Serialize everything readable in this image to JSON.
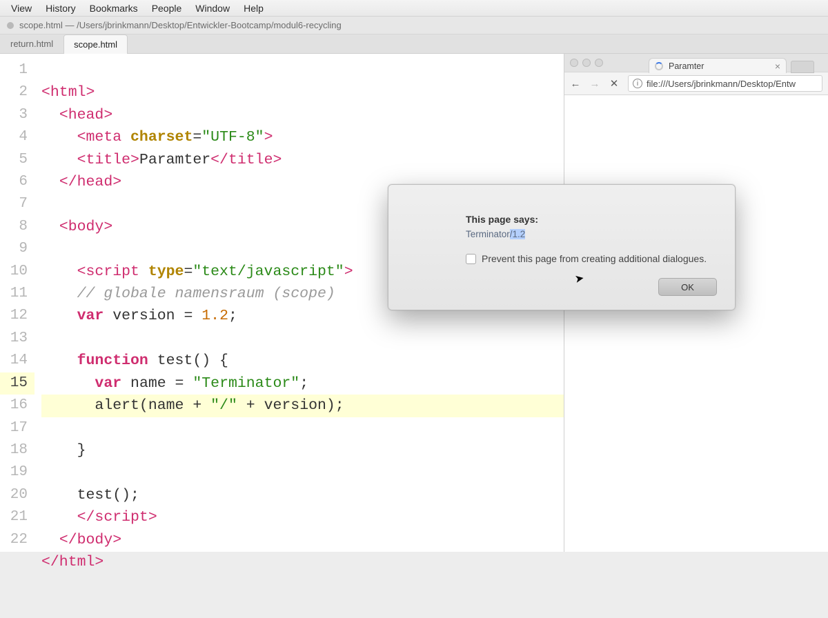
{
  "menubar": {
    "items": [
      "View",
      "History",
      "Bookmarks",
      "People",
      "Window",
      "Help"
    ]
  },
  "editor": {
    "title": "scope.html — /Users/jbrinkmann/Desktop/Entwickler-Bootcamp/modul6-recycling",
    "tabs": [
      {
        "label": "return.html",
        "active": false
      },
      {
        "label": "scope.html",
        "active": true
      }
    ],
    "lineNumbers": [
      "1",
      "2",
      "3",
      "4",
      "5",
      "6",
      "7",
      "8",
      "9",
      "10",
      "11",
      "12",
      "13",
      "14",
      "15",
      "16",
      "17",
      "18",
      "19",
      "20",
      "21",
      "22"
    ],
    "highlightLine": 15,
    "code": {
      "l1": {
        "tag1": "<html>",
        "raw": ""
      },
      "l2": {
        "indent": "  ",
        "tag": "<head>"
      },
      "l3": {
        "indent": "    ",
        "tagOpen": "<meta ",
        "attr": "charset",
        "eq": "=",
        "str": "\"UTF-8\"",
        "tagClose": ">"
      },
      "l4": {
        "indent": "    ",
        "open": "<title>",
        "text": "Paramter",
        "close": "</title>"
      },
      "l5": {
        "indent": "  ",
        "tag": "</head>"
      },
      "l6": {
        "raw": ""
      },
      "l7": {
        "indent": "  ",
        "tag": "<body>"
      },
      "l8": {
        "raw": ""
      },
      "l9": {
        "indent": "    ",
        "tagOpen": "<script ",
        "attr": "type",
        "eq": "=",
        "str": "\"text/javascript\"",
        "tagClose": ">"
      },
      "l10": {
        "indent": "    ",
        "comment": "// globale namensraum (scope)"
      },
      "l11": {
        "indent": "    ",
        "kw": "var",
        "rest1": " version = ",
        "num": "1.2",
        "rest2": ";"
      },
      "l12": {
        "raw": ""
      },
      "l13": {
        "indent": "    ",
        "kw": "function",
        "rest": " test() {"
      },
      "l14": {
        "indent": "      ",
        "kw": "var",
        "rest1": " name = ",
        "str": "\"Terminator\"",
        "rest2": ";"
      },
      "l15": {
        "indent": "      ",
        "rest1": "alert(name + ",
        "str1": "\"/\"",
        "rest2": " + version);"
      },
      "l16": {
        "indent": "    ",
        "rest": "}"
      },
      "l17": {
        "raw": ""
      },
      "l18": {
        "indent": "    ",
        "rest": "test();"
      },
      "l19": {
        "indent": "    ",
        "tag": "</script>"
      },
      "l20": {
        "indent": "  ",
        "tag": "</body>"
      },
      "l21": {
        "tag": "</html>"
      },
      "l22": {
        "raw": ""
      }
    }
  },
  "browser": {
    "tabTitle": "Paramter",
    "url": "file:///Users/jbrinkmann/Desktop/Entw",
    "nav": {
      "back": "←",
      "forward": "→",
      "stop": "✕",
      "info": "i"
    }
  },
  "alert": {
    "heading": "This page says:",
    "message_a": "Terminator",
    "message_b": "/1.2",
    "preventLabel": "Prevent this page from creating additional dialogues.",
    "okLabel": "OK"
  }
}
